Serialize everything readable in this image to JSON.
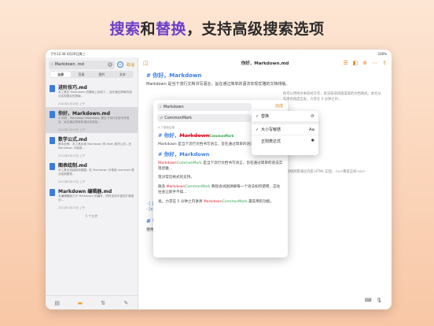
{
  "headline": {
    "part1": "搜索",
    "part2": "和",
    "part3": "替换",
    "part4": "，支持高级搜索选项"
  },
  "status": {
    "time": "下午12:36",
    "date": "4月20日周三",
    "battery": "100%"
  },
  "sidebar": {
    "search_value": "Markdown .md",
    "cancel_label": "取消",
    "segments": [
      "全部",
      "目录",
      "图片",
      "文本"
    ],
    "results": [
      {
        "title": "进阶技巧.md",
        "snippet": "本工具在 Markdown 的基础上实现了... 旨在通过简单的语法实现复杂的排版...",
        "date": "2022年4月18日 上午"
      },
      {
        "title": "你好，Markdown.md",
        "snippet": "# 你好，Markdown Markdown 是当下流行文档书写语言，旨在通过简单的语法实现优...",
        "date": "2022年4月19日 上午"
      },
      {
        "title": "数学公式.md",
        "snippet": "基本说明：本工具实现 Markdown 的 Math 数学公式...在 Markdown 中使用...",
        "date": "2022年4月19日 上午"
      },
      {
        "title": "图表绘制.md",
        "snippet": "本工具支持绘制流程图...在 Markdown 中使用 mermaid 语法绘制图表...",
        "date": "2022年3月15日 上午"
      },
      {
        "title": "Markdown 编辑器.md",
        "snippet": "本编辑器致力于 Markdown 的编写，同时支持丰富的扩展语法...",
        "date": "2022年3月15日 上午"
      }
    ],
    "count_label": "5 个文件"
  },
  "editor": {
    "title": "你好，Markdown.md",
    "heading": "# 你好，Markdown",
    "para1": "Markdown 是当下流行文档书写语言，旨在通过简单的语法实现优雅的文档排版。",
    "para_bg1": "你可以用纯文本形式写作，再渲染成排版美观的文档格式。本文从实用的角度出发，力求在 5 分钟之内...",
    "para_bg2": "下划线则需通过内嵌 HTML 实现。<u>像是这样</u>",
    "list1": "- [ ] 未选择",
    "list2": "- [x] 已选择",
    "heading2": "# 链接和图片",
    "para_bottom": "使用中括号包裹标题，小括号包裹内容："
  },
  "find": {
    "search_value": "Markdown",
    "replace_value": "CommonMark",
    "done_label": "完成",
    "next_label": "替换",
    "count_label": "8 个搜索结果",
    "preview": {
      "heading_prefix": "# 你好，",
      "heading_old": "Markdown",
      "heading_new": "CommonMark",
      "line1": "Markdown 是当下流行文档书写语言，旨在通过简单的语法实现优雅...",
      "heading2": "# 你好，Markdown",
      "line2_old": "Markdown",
      "line2_new": "CommonMark",
      "line2_rest": " 是当下流行文档书写语言，旨在通过简单的语法实现优雅...",
      "line3": "现对常见格式的支持。",
      "line4_pre": "跟多 ",
      "line4_old": "Markdown",
      "line4_new": "CommonMark",
      "line4_rest": " 教程会试图讲解每一个语法如何使用，这往往会让新手不知...",
      "line5_pre": "发。力求在 5 分钟之内讲清 ",
      "line5_old": "Markdown",
      "line5_new": "CommonMark",
      "line5_rest": " 最常用的功能。"
    }
  },
  "menu": {
    "items": [
      {
        "label": "替换",
        "checked": true,
        "icon": "⟳"
      },
      {
        "label": "大小写敏感",
        "checked": true,
        "icon": "Aa"
      },
      {
        "label": "正则表达式",
        "checked": false,
        "icon": "✱"
      }
    ]
  }
}
